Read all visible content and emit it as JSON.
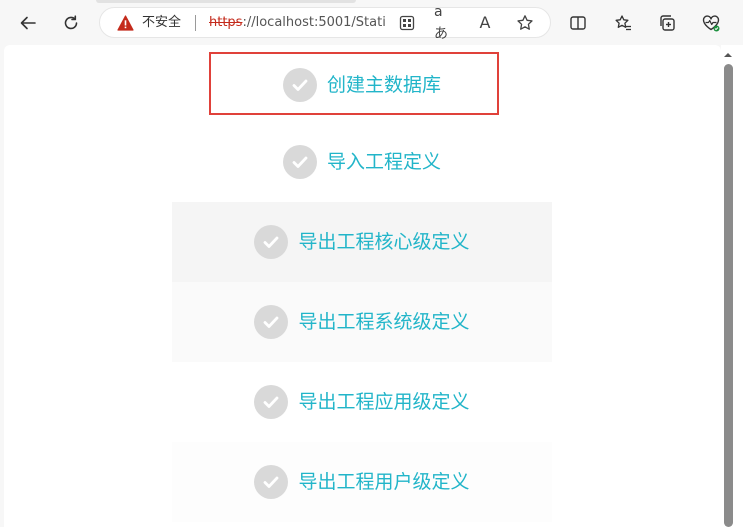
{
  "browser": {
    "security_label": "不安全",
    "url_scheme": "https",
    "url_rest": "://localhost:5001/Stati...",
    "read_aloud_glyph": "A",
    "translate_glyph": "aあ"
  },
  "steps": [
    {
      "label": "创建主数据库",
      "highlighted": true
    },
    {
      "label": "导入工程定义"
    },
    {
      "label": "导出工程核心级定义"
    },
    {
      "label": "导出工程系统级定义"
    },
    {
      "label": "导出工程应用级定义"
    },
    {
      "label": "导出工程用户级定义"
    }
  ],
  "colors": {
    "step_text": "#22b5c9",
    "check_circle": "#d9d9d9",
    "highlight_border": "#e0413a",
    "warning_red": "#c42b1c"
  }
}
